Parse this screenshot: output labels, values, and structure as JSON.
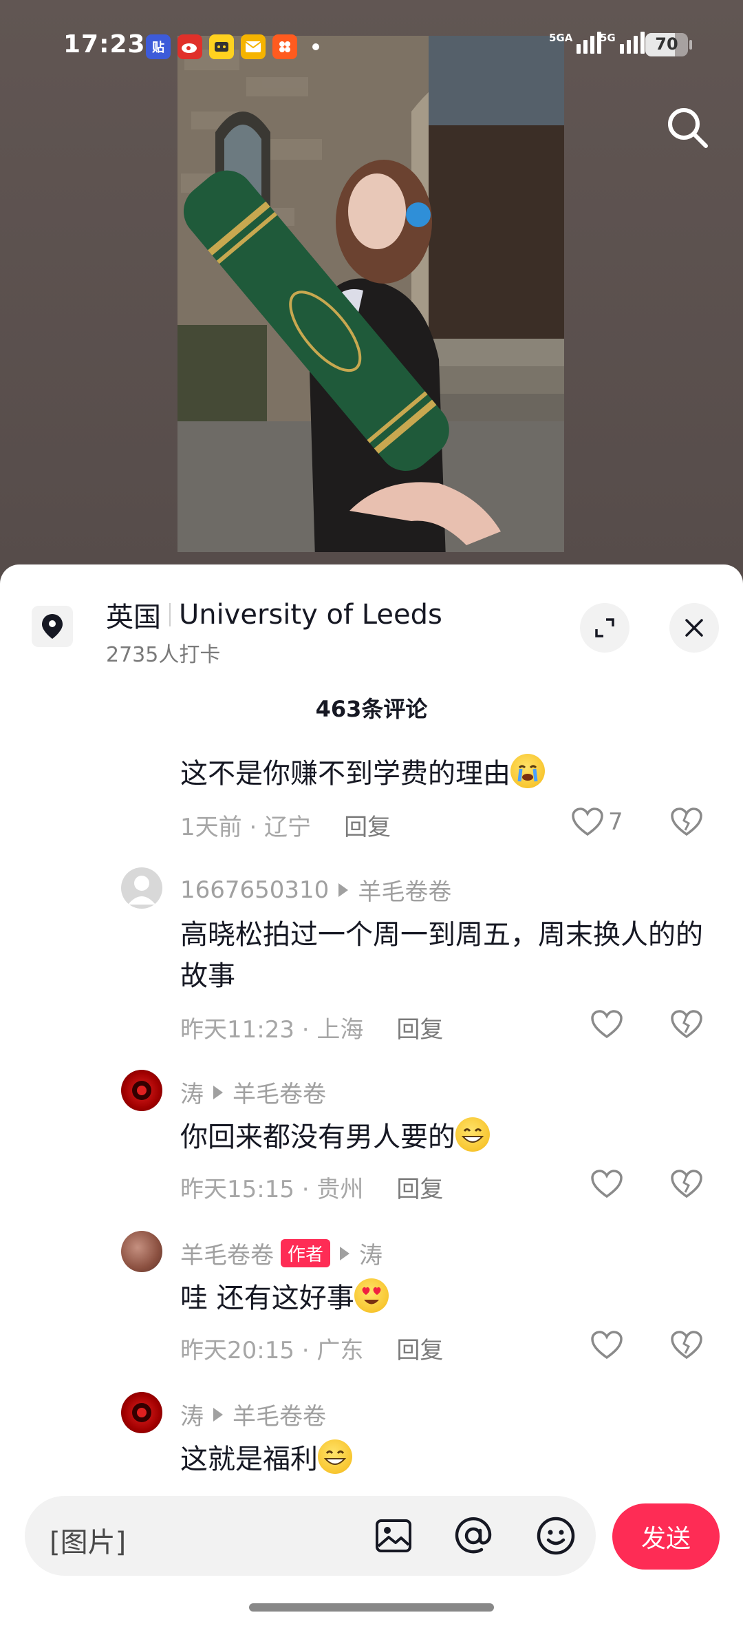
{
  "status_bar": {
    "time": "17:23",
    "app_icons": [
      "贴",
      "微博",
      "闲鱼",
      "邮件",
      "小红书"
    ],
    "signal1_label": "5GA",
    "signal2_label": "5G",
    "battery": "70"
  },
  "location": {
    "country": "英国",
    "name": "University of Leeds",
    "checkins": "2735人打卡"
  },
  "comments_count": "463条评论",
  "comments": [
    {
      "text": "这不是你赚不到学费的理由",
      "meta": "1天前 · 辽宁",
      "reply": "回复",
      "likes": "7"
    },
    {
      "user": "1667650310",
      "reply_to": "羊毛卷卷",
      "text": "高晓松拍过一个周一到周五，周末换人的的故事",
      "meta": "昨天11:23 · 上海",
      "reply": "回复"
    },
    {
      "user": "涛",
      "reply_to": "羊毛卷卷",
      "text": "你回来都没有男人要的",
      "meta": "昨天15:15 · 贵州",
      "reply": "回复"
    },
    {
      "user": "羊毛卷卷",
      "badge": "作者",
      "reply_to": "涛",
      "text": "哇 还有这好事",
      "meta": "昨天20:15 · 广东",
      "reply": "回复"
    },
    {
      "user": "涛",
      "reply_to": "羊毛卷卷",
      "text": "这就是福利"
    }
  ],
  "input": {
    "placeholder": "[图片]",
    "send_label": "发送"
  },
  "colors": {
    "accent": "#fe2c55",
    "text_primary": "#161823",
    "text_secondary": "#a0a0a0"
  }
}
